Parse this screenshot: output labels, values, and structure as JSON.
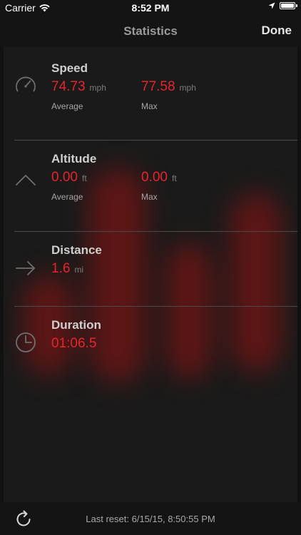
{
  "status_bar": {
    "carrier": "Carrier",
    "time": "8:52 PM",
    "battery_level": 1.0
  },
  "nav": {
    "title": "Statistics",
    "done_label": "Done"
  },
  "sections": {
    "speed": {
      "title": "Speed",
      "icon": "speedometer-icon",
      "average_value": "74.73",
      "average_unit": "mph",
      "average_label": "Average",
      "max_value": "77.58",
      "max_unit": "mph",
      "max_label": "Max"
    },
    "altitude": {
      "title": "Altitude",
      "icon": "chevron-up-icon",
      "average_value": "0.00",
      "average_unit": "ft",
      "average_label": "Average",
      "max_value": "0.00",
      "max_unit": "ft",
      "max_label": "Max"
    },
    "distance": {
      "title": "Distance",
      "icon": "arrow-right-icon",
      "value": "1.6",
      "unit": "mi"
    },
    "duration": {
      "title": "Duration",
      "icon": "clock-icon",
      "value": "01:06.5"
    }
  },
  "footer": {
    "refresh_icon": "refresh-icon",
    "reset_text": "Last reset: 6/15/15, 8:50:55 PM"
  },
  "colors": {
    "accent_red": "#e8242b",
    "background": "#141414",
    "panel": "#1a1a1a"
  }
}
